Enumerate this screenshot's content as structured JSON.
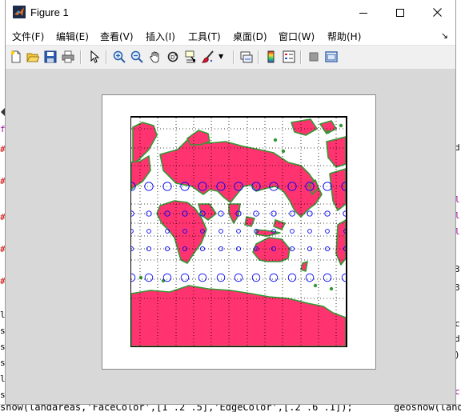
{
  "window": {
    "title": "Figure 1",
    "controls": [
      "minimize",
      "maximize",
      "close"
    ]
  },
  "menu": {
    "items": [
      {
        "id": "file",
        "label": "文件(F)"
      },
      {
        "id": "edit",
        "label": "编辑(E)"
      },
      {
        "id": "view",
        "label": "查看(V)"
      },
      {
        "id": "insert",
        "label": "插入(I)"
      },
      {
        "id": "tools",
        "label": "工具(T)"
      },
      {
        "id": "desktop",
        "label": "桌面(D)"
      },
      {
        "id": "window",
        "label": "窗口(W)"
      },
      {
        "id": "help",
        "label": "帮助(H)"
      }
    ],
    "dock_glyph": "↘"
  },
  "toolbar": {
    "buttons": [
      "new-figure-icon",
      "open-file-icon",
      "save-icon",
      "print-icon",
      "pointer-icon",
      "zoom-in-icon",
      "zoom-out-icon",
      "pan-hand-icon",
      "rotate-3d-icon",
      "data-cursor-icon",
      "brush-icon",
      "link-plot-icon",
      "colorbar-icon",
      "legend-icon",
      "hide-plot-tools-icon",
      "show-plot-tools-icon"
    ]
  },
  "figure": {
    "land_face_color": "#ff3370",
    "land_edge_color": "#339933",
    "indicatrix_color": "#0000ff",
    "grid_style": "dotted"
  },
  "background_editor": {
    "bottom_line": "show(landareas,'FaceColor',[1 .2 .5],'EdgeColor',[.2 .6 .1]);",
    "bottom_line_right": "geoshow(land"
  }
}
